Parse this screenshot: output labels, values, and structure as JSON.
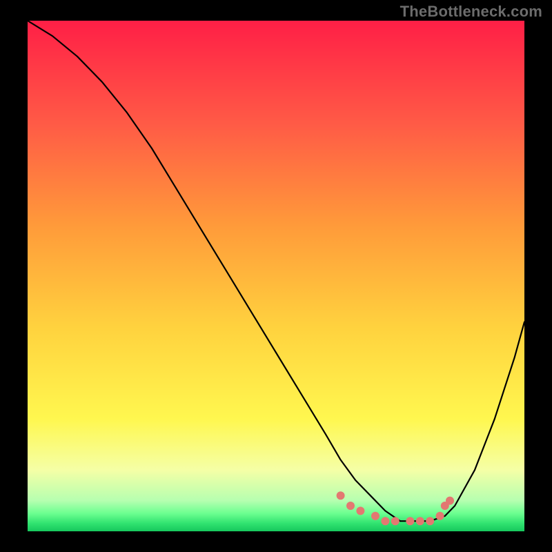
{
  "attribution": "TheBottleneck.com",
  "chart_data": {
    "type": "line",
    "title": "",
    "xlabel": "",
    "ylabel": "",
    "x_range": [
      0,
      100
    ],
    "y_range": [
      0,
      100
    ],
    "axes_visible": false,
    "grid": false,
    "background": {
      "type": "vertical_gradient",
      "stops": [
        {
          "offset": 0.0,
          "color": "#ff1f46"
        },
        {
          "offset": 0.2,
          "color": "#ff5a46"
        },
        {
          "offset": 0.4,
          "color": "#ff9a3a"
        },
        {
          "offset": 0.6,
          "color": "#ffd23e"
        },
        {
          "offset": 0.78,
          "color": "#fff74f"
        },
        {
          "offset": 0.88,
          "color": "#f5ffa6"
        },
        {
          "offset": 0.94,
          "color": "#b6ffb0"
        },
        {
          "offset": 0.965,
          "color": "#6cff90"
        },
        {
          "offset": 0.985,
          "color": "#2fe26f"
        },
        {
          "offset": 1.0,
          "color": "#17c85d"
        }
      ]
    },
    "series": [
      {
        "name": "bottleneck_curve",
        "color": "#000000",
        "x": [
          0,
          5,
          10,
          15,
          20,
          25,
          30,
          35,
          40,
          45,
          50,
          55,
          60,
          63,
          66,
          69,
          72,
          75,
          78,
          81,
          84,
          86,
          90,
          94,
          98,
          100
        ],
        "y": [
          100,
          97,
          93,
          88,
          82,
          75,
          67,
          59,
          51,
          43,
          35,
          27,
          19,
          14,
          10,
          7,
          4,
          2,
          2,
          2,
          3,
          5,
          12,
          22,
          34,
          41
        ]
      }
    ],
    "marker_points": {
      "name": "optimal_zone_markers",
      "color": "#e37871",
      "radius": 6,
      "x": [
        63,
        65,
        67,
        70,
        72,
        74,
        77,
        79,
        81,
        83,
        84,
        85
      ],
      "y": [
        7,
        5,
        4,
        3,
        2,
        2,
        2,
        2,
        2,
        3,
        5,
        6
      ]
    }
  }
}
